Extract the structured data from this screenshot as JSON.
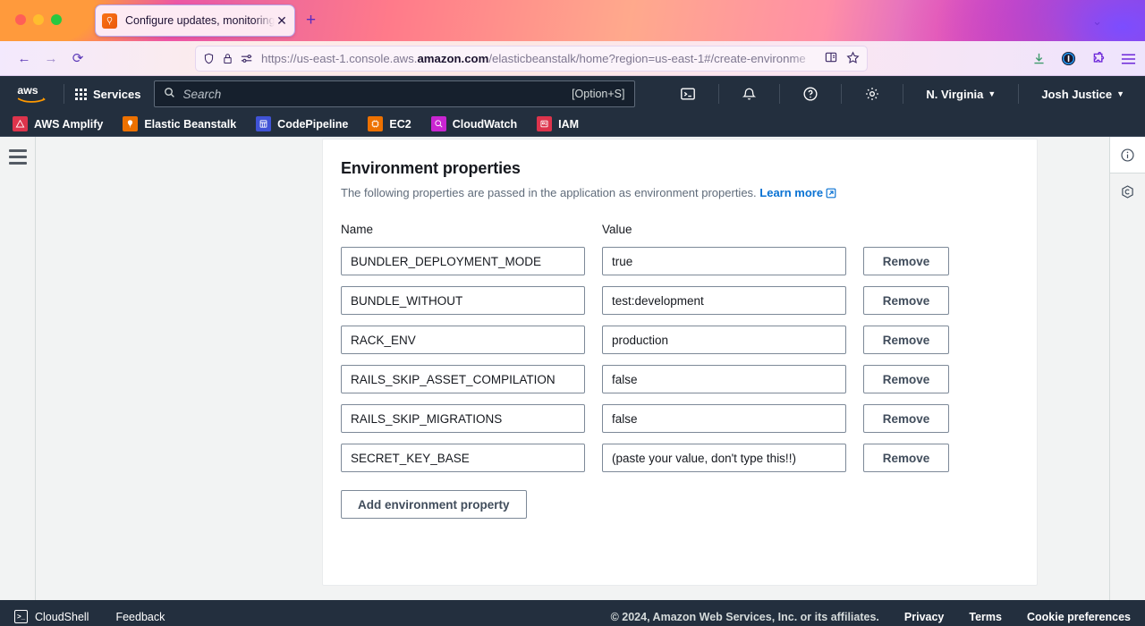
{
  "browser": {
    "tab": {
      "title": "Configure updates, monitoring,",
      "favicon": "elastic-beanstalk-icon",
      "close_label": "✕"
    },
    "new_tab_label": "+",
    "tabstrip_chevron": "⌄",
    "nav": {
      "back": "←",
      "forward": "→",
      "reload": "⟳"
    },
    "url": {
      "prefix": "https://us-east-1.console.aws.",
      "domain": "amazon.com",
      "suffix": "/elasticbeanstalk/home?region=us-east-1#/create-environme",
      "shield_icon": "shield-icon",
      "lock_icon": "lock-icon",
      "permissions_icon": "permissions-icon",
      "reader_icon": "reader-view-icon",
      "bookmark_icon": "bookmark-star-icon"
    },
    "toolbar_icons": [
      "downloads-icon",
      "account-icon",
      "extensions-icon",
      "app-menu-icon"
    ]
  },
  "aws_nav": {
    "logo_alt": "aws",
    "services_label": "Services",
    "search": {
      "placeholder": "Search",
      "shortcut": "[Option+S]",
      "icon": "search-icon"
    },
    "right_icons": [
      "cloudshell-icon",
      "notifications-bell-icon",
      "help-question-icon",
      "settings-gear-icon"
    ],
    "region": "N. Virginia",
    "account": "Josh Justice",
    "caret": "▼"
  },
  "shortcuts": [
    {
      "label": "AWS Amplify",
      "color": "#dd344c",
      "glyph": "△"
    },
    {
      "label": "Elastic Beanstalk",
      "color": "#ed7100",
      "glyph": "☁"
    },
    {
      "label": "CodePipeline",
      "color": "#4053d6",
      "glyph": "▓"
    },
    {
      "label": "EC2",
      "color": "#ed7100",
      "glyph": "⬚"
    },
    {
      "label": "CloudWatch",
      "color": "#c925d1",
      "glyph": "◔"
    },
    {
      "label": "IAM",
      "color": "#dd344c",
      "glyph": "☰"
    }
  ],
  "panel": {
    "title": "Environment properties",
    "description": "The following properties are passed in the application as environment properties.",
    "learn_more": "Learn more",
    "columns": {
      "name": "Name",
      "value": "Value"
    },
    "remove_label": "Remove",
    "add_label": "Add environment property",
    "properties": [
      {
        "name": "BUNDLER_DEPLOYMENT_MODE",
        "value": "true"
      },
      {
        "name": "BUNDLE_WITHOUT",
        "value": "test:development"
      },
      {
        "name": "RACK_ENV",
        "value": "production"
      },
      {
        "name": "RAILS_SKIP_ASSET_COMPILATION",
        "value": "false"
      },
      {
        "name": "RAILS_SKIP_MIGRATIONS",
        "value": "false"
      },
      {
        "name": "SECRET_KEY_BASE",
        "value": "(paste your value, don't type this!!)"
      }
    ]
  },
  "right_rail": {
    "icons": [
      "info-circle-icon",
      "shortcuts-hexagon-icon"
    ]
  },
  "footer": {
    "cloudshell": "CloudShell",
    "feedback": "Feedback",
    "copyright": "© 2024, Amazon Web Services, Inc. or its affiliates.",
    "links": [
      "Privacy",
      "Terms",
      "Cookie preferences"
    ]
  }
}
